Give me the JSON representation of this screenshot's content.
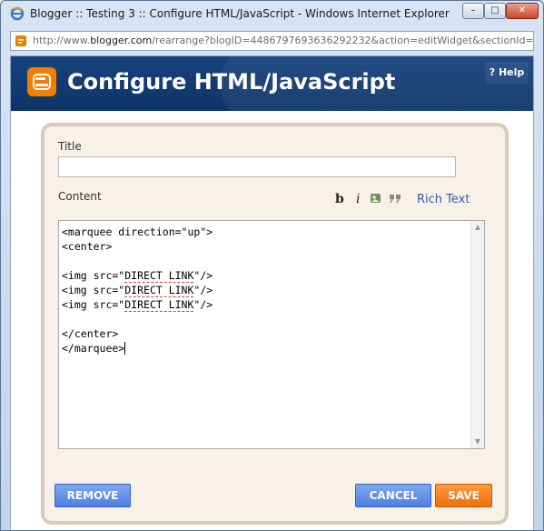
{
  "window": {
    "title": "Blogger :: Testing 3 :: Configure HTML/JavaScript - Windows Internet Explorer",
    "minimize_glyph": "–",
    "maximize_glyph": "□",
    "close_glyph": "✕"
  },
  "address_bar": {
    "prefix": "http://www.",
    "domain": "blogger.com",
    "rest": "/rearrange?blogID=4486797693636292232&action=editWidget&sectionId=sid"
  },
  "header": {
    "title": "Configure HTML/JavaScript",
    "help_label": "? Help"
  },
  "form": {
    "title_label": "Title",
    "title_value": "",
    "content_label": "Content",
    "toolbar": {
      "bold": "b",
      "italic": "i",
      "rich_text_label": "Rich Text"
    },
    "code_lines": [
      "<marquee direction=\"up\">",
      "<center>",
      "",
      "<img src=\"DIRECT LINK\"/>",
      "<img src=\"DIRECT LINK\"/>",
      "<img src=\"DIRECT LINK\"/>",
      "",
      "</center>",
      "</marquee>"
    ]
  },
  "buttons": {
    "remove": "REMOVE",
    "cancel": "CANCEL",
    "save": "SAVE"
  },
  "colors": {
    "header_bg": "#15407a",
    "brand_orange": "#f57d00",
    "button_blue": "#5b8ae6",
    "button_orange": "#f47a1e",
    "panel_border": "#d8cbb6"
  }
}
